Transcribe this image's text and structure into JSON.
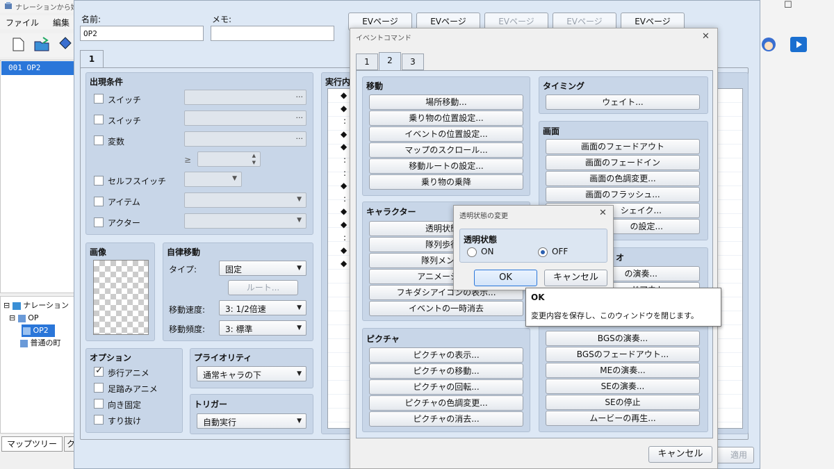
{
  "app": {
    "title": "ナレーションから始ま",
    "menu": [
      "ファイル",
      "編集"
    ],
    "window_controls": [
      "—",
      "☐"
    ],
    "map_list": {
      "selected": "001 OP2"
    },
    "tree": [
      "ナレーション",
      "OP",
      "OP2",
      "普通の町"
    ],
    "tree_tab": "マップツリー",
    "tree_tab_second": "ク"
  },
  "event_editor": {
    "name_label": "名前:",
    "name_value": "OP2",
    "memo_label": "メモ:",
    "memo_value": "",
    "ev_pages": [
      "EVページ",
      "EVページ",
      "EVページ",
      "EVページ",
      "EVページ"
    ],
    "page_tab": "1",
    "conditions": {
      "header": "出現条件",
      "items": [
        "スイッチ",
        "スイッチ",
        "変数",
        "セルフスイッチ",
        "アイテム",
        "アクター"
      ],
      "geq": "≥"
    },
    "image": {
      "header": "画像"
    },
    "autonomous": {
      "header": "自律移動",
      "type_label": "タイプ:",
      "type_value": "固定",
      "route_button": "ルート...",
      "speed_label": "移動速度:",
      "speed_value": "3: 1/2倍速",
      "freq_label": "移動頻度:",
      "freq_value": "3: 標準"
    },
    "options": {
      "header": "オプション",
      "items": [
        {
          "label": "歩行アニメ",
          "checked": true
        },
        {
          "label": "足踏みアニメ",
          "checked": false
        },
        {
          "label": "向き固定",
          "checked": false
        },
        {
          "label": "すり抜け",
          "checked": false
        }
      ]
    },
    "priority": {
      "header": "プライオリティ",
      "value": "通常キャラの下"
    },
    "trigger": {
      "header": "トリガー",
      "value": "自動実行"
    },
    "exec": {
      "header": "実行内",
      "markers": [
        "◆",
        "◆",
        ":",
        "◆",
        "◆",
        ":",
        ":",
        "◆",
        ":",
        "◆",
        "◆",
        ":",
        "◆",
        "◆"
      ]
    },
    "apply_button": "適用"
  },
  "command_window": {
    "title": "イベントコマンド",
    "close": "✕",
    "tabs": [
      "1",
      "2",
      "3"
    ],
    "active_tab": "2",
    "move": {
      "header": "移動",
      "buttons": [
        "場所移動...",
        "乗り物の位置設定...",
        "イベントの位置設定...",
        "マップのスクロール...",
        "移動ルートの設定...",
        "乗り物の乗降"
      ]
    },
    "character": {
      "header": "キャラクター",
      "buttons": [
        "透明状態の",
        "隊列歩行の",
        "隊列メンバー",
        "アニメーション",
        "フキダシアイコンの表示...",
        "イベントの一時消去"
      ]
    },
    "picture": {
      "header": "ピクチャ",
      "buttons": [
        "ピクチャの表示...",
        "ピクチャの移動...",
        "ピクチャの回転...",
        "ピクチャの色調変更...",
        "ピクチャの消去..."
      ]
    },
    "timing": {
      "header": "タイミング",
      "buttons": [
        "ウェイト..."
      ]
    },
    "screen": {
      "header": "画面",
      "buttons": [
        "画面のフェードアウト",
        "画面のフェードイン",
        "画面の色調変更...",
        "画面のフラッシュ...",
        "シェイク...",
        "の設定..."
      ]
    },
    "audio": {
      "header_tail": "オ",
      "buttons": [
        "の演奏...",
        "ドアウト",
        "BGSの演奏...",
        "BGSのフェードアウト...",
        "MEの演奏...",
        "SEの演奏...",
        "SEの停止",
        "ムービーの再生..."
      ]
    },
    "cancel_button": "キャンセル"
  },
  "transparency_dialog": {
    "title": "透明状態の変更",
    "close": "✕",
    "group_label": "透明状態",
    "options": [
      "ON",
      "OFF"
    ],
    "selected": "OFF",
    "ok": "OK",
    "cancel": "キャンセル"
  },
  "tooltip": {
    "title": "OK",
    "text": "変更内容を保存し、このウィンドウを閉じます。"
  },
  "colors": {
    "selection": "#2a76d9",
    "panel": "#c8d6e8",
    "window_bg": "#dde8f5",
    "accent_blue": "#2a5fb0"
  }
}
